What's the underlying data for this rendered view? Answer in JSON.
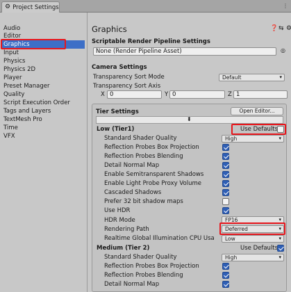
{
  "window": {
    "tab_title": "Project Settings",
    "tab_menu": "⋮"
  },
  "sidebar": {
    "items": [
      {
        "label": "Audio"
      },
      {
        "label": "Editor"
      },
      {
        "label": "Graphics",
        "selected": true
      },
      {
        "label": "Input"
      },
      {
        "label": "Physics"
      },
      {
        "label": "Physics 2D"
      },
      {
        "label": "Player"
      },
      {
        "label": "Preset Manager"
      },
      {
        "label": "Quality"
      },
      {
        "label": "Script Execution Order"
      },
      {
        "label": "Tags and Layers"
      },
      {
        "label": "TextMesh Pro"
      },
      {
        "label": "Time"
      },
      {
        "label": "VFX"
      }
    ]
  },
  "main": {
    "title": "Graphics",
    "srp": {
      "heading": "Scriptable Render Pipeline Settings",
      "value": "None (Render Pipeline Asset)"
    },
    "camera": {
      "heading": "Camera Settings",
      "sort_mode_label": "Transparency Sort Mode",
      "sort_mode_value": "Default",
      "sort_axis_label": "Transparency Sort Axis",
      "x_label": "X",
      "x_value": "0",
      "y_label": "Y",
      "y_value": "0",
      "z_label": "Z",
      "z_value": "1"
    },
    "tier": {
      "heading": "Tier Settings",
      "open_editor": "Open Editor...",
      "bar_icon": "⬍",
      "low": {
        "title": "Low (Tier1)",
        "use_defaults_label": "Use Defaults",
        "use_defaults": false,
        "rows": [
          {
            "label": "Standard Shader Quality",
            "type": "dropdown",
            "value": "High"
          },
          {
            "label": "Reflection Probes Box Projection",
            "type": "check",
            "checked": true
          },
          {
            "label": "Reflection Probes Blending",
            "type": "check",
            "checked": true
          },
          {
            "label": "Detail Normal Map",
            "type": "check",
            "checked": true
          },
          {
            "label": "Enable Semitransparent Shadows",
            "type": "check",
            "checked": true
          },
          {
            "label": "Enable Light Probe Proxy Volume",
            "type": "check",
            "checked": true
          },
          {
            "label": "Cascaded Shadows",
            "type": "check",
            "checked": true
          },
          {
            "label": "Prefer 32 bit shadow maps",
            "type": "check",
            "checked": false
          },
          {
            "label": "Use HDR",
            "type": "check",
            "checked": true
          },
          {
            "label": "HDR Mode",
            "type": "dropdown",
            "value": "FP16"
          },
          {
            "label": "Rendering Path",
            "type": "dropdown",
            "value": "Deferred"
          },
          {
            "label": "Realtime Global Illumination CPU Usa",
            "type": "dropdown",
            "value": "Low"
          }
        ]
      },
      "medium": {
        "title": "Medium (Tier 2)",
        "use_defaults_label": "Use Defaults",
        "use_defaults": true,
        "rows": [
          {
            "label": "Standard Shader Quality",
            "type": "dropdown",
            "value": "High"
          },
          {
            "label": "Reflection Probes Box Projection",
            "type": "check",
            "checked": true
          },
          {
            "label": "Reflection Probes Blending",
            "type": "check",
            "checked": true
          },
          {
            "label": "Detail Normal Map",
            "type": "check",
            "checked": true
          }
        ]
      }
    }
  },
  "colors": {
    "selection": "#3d6fc7",
    "highlight": "#e8151b",
    "checkbox_on": "#2f5fb5"
  }
}
